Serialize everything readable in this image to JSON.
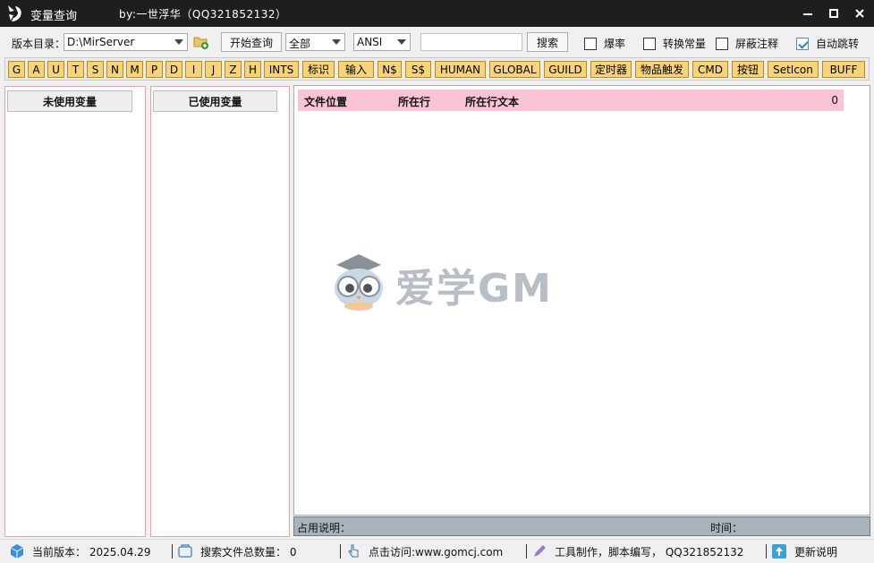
{
  "window": {
    "title": "变量查询",
    "byline": "by:一世浮华（QQ321852132）"
  },
  "toolbar": {
    "dir_label": "版本目录：",
    "dir_value": "D:\\MirServer",
    "start_query_label": "开始查询",
    "scope_value": "全部",
    "encoding_value": "ANSI",
    "search_value": "",
    "search_label": "搜索",
    "checkboxes": [
      {
        "label": "爆率",
        "checked": false
      },
      {
        "label": "转换常量",
        "checked": false
      },
      {
        "label": "屏蔽注释",
        "checked": false
      },
      {
        "label": "自动跳转",
        "checked": true
      }
    ]
  },
  "var_buttons": [
    "G",
    "A",
    "U",
    "T",
    "S",
    "N",
    "M",
    "P",
    "D",
    "I",
    "J",
    "Z",
    "H",
    "INTS",
    "标识",
    "输入",
    "N$",
    "S$",
    "HUMAN",
    "GLOBAL",
    "GUILD",
    "定时器",
    "物品触发",
    "CMD",
    "按钮",
    "SetIcon",
    "BUFF"
  ],
  "panels": {
    "unused_header": "未使用变量",
    "used_header": "已使用变量"
  },
  "results": {
    "col_file": "文件位置",
    "col_line": "所在行",
    "col_text": "所在行文本",
    "count": "0"
  },
  "status": {
    "usage_label": "占用说明：",
    "time_label": "时间："
  },
  "bottom": {
    "version": "当前版本：  2025.04.29",
    "file_count": "搜索文件总数量：  0",
    "visit": "点击访问:www.gomcj.com",
    "credit": "工具制作，脚本编写，  QQ321852132",
    "update": "更新说明"
  },
  "watermark": {
    "text": "爱学GM"
  },
  "colors": {
    "titlebar": "#1e1e1e",
    "var_button": "#f7d37a",
    "results_header": "#fbc4d6",
    "status_strip": "#a9b3bd"
  }
}
